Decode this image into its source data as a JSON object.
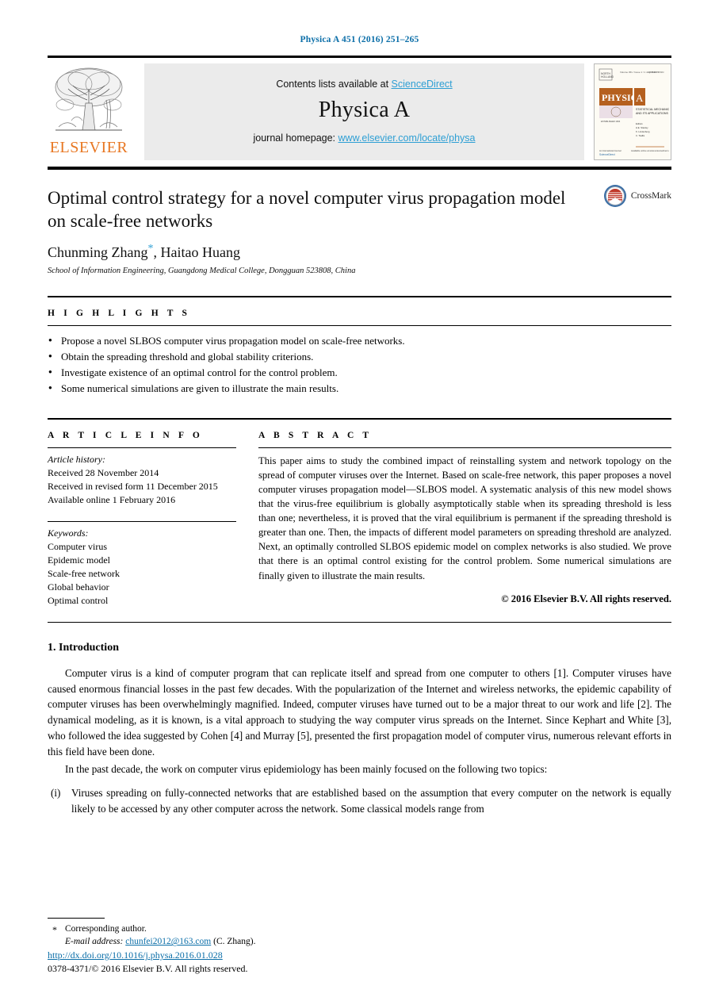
{
  "running_head": "Physica A 451 (2016) 251–265",
  "masthead": {
    "publisher_logo_word": "ELSEVIER",
    "contents_prefix": "Contents lists available at ",
    "contents_link": "ScienceDirect",
    "journal_name": "Physica A",
    "homepage_prefix": "journal homepage: ",
    "homepage_link": "www.elsevier.com/locate/physa",
    "cover": {
      "title": "PHYSICA",
      "volume_letter": "A",
      "subtitle": "STATISTICAL MECHANICS AND ITS APPLICATIONS"
    }
  },
  "title_block": {
    "title": "Optimal control strategy for a novel computer virus propagation model on scale-free networks",
    "authors": "Chunming Zhang",
    "corresponding_marker": "*",
    "authors_rest": ", Haitao Huang",
    "affiliation": "School of Information Engineering, Guangdong Medical College, Dongguan 523808, China",
    "crossmark_label": "CrossMark"
  },
  "highlights": {
    "label": "H I G H L I G H T S",
    "items": [
      "Propose a novel SLBOS computer virus propagation model on scale-free networks.",
      "Obtain the spreading threshold and global stability criterions.",
      "Investigate existence of an optimal control for the control problem.",
      "Some numerical simulations are given to illustrate the main results."
    ]
  },
  "article_info": {
    "label": "A R T I C L E    I N F O",
    "history_heading": "Article history:",
    "history": [
      "Received 28 November 2014",
      "Received in revised form 11 December 2015",
      "Available online 1 February 2016"
    ],
    "keywords_heading": "Keywords:",
    "keywords": [
      "Computer virus",
      "Epidemic model",
      "Scale-free network",
      "Global behavior",
      "Optimal control"
    ]
  },
  "abstract": {
    "label": "A B S T R A C T",
    "text": "This paper aims to study the combined impact of reinstalling system and network topology on the spread of computer viruses over the Internet. Based on scale-free network, this paper proposes a novel computer viruses propagation model—SLBOS model. A systematic analysis of this new model shows that the virus-free equilibrium is globally asymptotically stable when its spreading threshold is less than one; nevertheless, it is proved that the viral equilibrium is permanent if the spreading threshold is greater than one. Then, the impacts of different model parameters on spreading threshold are analyzed. Next, an optimally controlled SLBOS epidemic model on complex networks is also studied. We prove that there is an optimal control existing for the control problem. Some numerical simulations are finally given to illustrate the main results.",
    "copyright": "© 2016 Elsevier B.V. All rights reserved."
  },
  "introduction": {
    "heading": "1. Introduction",
    "paragraph_1": "Computer virus is a kind of computer program that can replicate itself and spread from one computer to others [1]. Computer viruses have caused enormous financial losses in the past few decades. With the popularization of the Internet and wireless networks, the epidemic capability of computer viruses has been overwhelmingly magnified. Indeed, computer viruses have turned out to be a major threat to our work and life [2]. The dynamical modeling, as it is known, is a vital approach to studying the way computer virus spreads on the Internet. Since Kephart and White [3], who followed the idea suggested by Cohen [4] and Murray [5], presented the first propagation model of computer virus, numerous relevant efforts in this field have been done.",
    "paragraph_2": "In the past decade, the work on computer virus epidemiology has been mainly focused on the following two topics:",
    "list_item_marker": "(i)",
    "list_item_text": "Viruses spreading on fully-connected networks that are established based on the assumption that every computer on the network is equally likely to be accessed by any other computer across the network. Some classical models range from"
  },
  "footer": {
    "corresponding_star": "*",
    "corresponding_text": "Corresponding author.",
    "email_label": "E-mail address:",
    "email": "chunfei2012@163.com",
    "email_suffix": "(C. Zhang).",
    "doi": "http://dx.doi.org/10.1016/j.physa.2016.01.028",
    "issn_line": "0378-4371/© 2016 Elsevier B.V. All rights reserved."
  },
  "colors": {
    "link_blue": "#2e9fd4",
    "head_blue": "#0b6ea8",
    "elsevier_orange": "#e87722",
    "band_gray": "#ebebeb"
  }
}
